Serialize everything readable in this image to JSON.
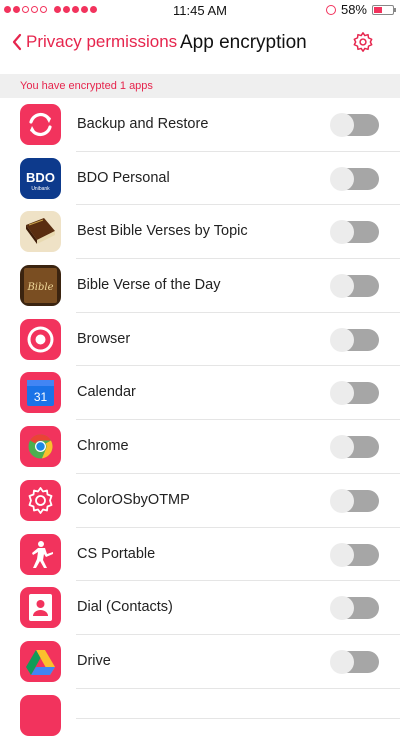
{
  "status": {
    "time": "11:45 AM",
    "battery": "58%",
    "battery_level": 0.58
  },
  "nav": {
    "back_label": "Privacy permissions",
    "title": "App encryption"
  },
  "banner": {
    "text": "You have encrypted 1 apps"
  },
  "apps": [
    {
      "label": "Backup and Restore",
      "icon": "backup-restore-icon",
      "enabled": false
    },
    {
      "label": "BDO Personal",
      "icon": "bdo-icon",
      "enabled": false
    },
    {
      "label": "Best Bible Verses by Topic",
      "icon": "bible-book-icon",
      "enabled": false
    },
    {
      "label": "Bible Verse of the Day",
      "icon": "bible-icon",
      "enabled": false
    },
    {
      "label": "Browser",
      "icon": "browser-icon",
      "enabled": false
    },
    {
      "label": "Calendar",
      "icon": "calendar-icon",
      "enabled": false
    },
    {
      "label": "Chrome",
      "icon": "chrome-icon",
      "enabled": false
    },
    {
      "label": "ColorOSbyOTMP",
      "icon": "gear-icon",
      "enabled": false
    },
    {
      "label": "CS Portable",
      "icon": "soldier-icon",
      "enabled": false
    },
    {
      "label": "Dial (Contacts)",
      "icon": "contacts-icon",
      "enabled": false
    },
    {
      "label": "Drive",
      "icon": "drive-icon",
      "enabled": false
    }
  ],
  "icon_texts": {
    "bdo": "BDO",
    "bdo_sub": "Unibank",
    "bible": "Bible",
    "calendar_day": "31"
  },
  "colors": {
    "accent": "#e6254d",
    "icon_red": "#f2335d",
    "toggle_off": "#a6a6a6"
  }
}
